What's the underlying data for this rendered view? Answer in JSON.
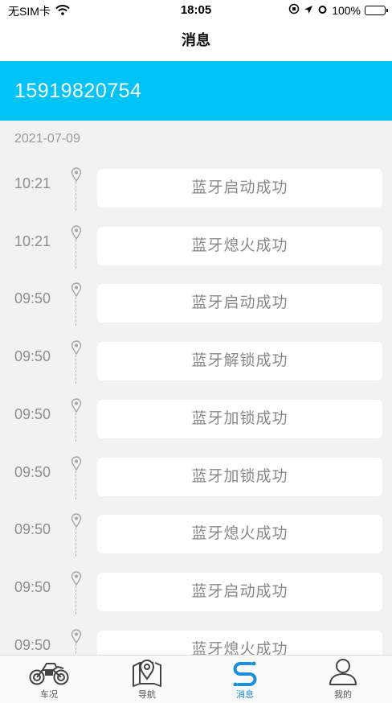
{
  "status_bar": {
    "carrier": "无SIM卡",
    "time": "18:05",
    "battery": "100%"
  },
  "header": {
    "title": "消息"
  },
  "account": {
    "phone": "15919820754"
  },
  "date": "2021-07-09",
  "messages": [
    {
      "time": "10:21",
      "text": "蓝牙启动成功"
    },
    {
      "time": "10:21",
      "text": "蓝牙熄火成功"
    },
    {
      "time": "09:50",
      "text": "蓝牙启动成功"
    },
    {
      "time": "09:50",
      "text": "蓝牙解锁成功"
    },
    {
      "time": "09:50",
      "text": "蓝牙加锁成功"
    },
    {
      "time": "09:50",
      "text": "蓝牙加锁成功"
    },
    {
      "time": "09:50",
      "text": "蓝牙熄火成功"
    },
    {
      "time": "09:50",
      "text": "蓝牙启动成功"
    },
    {
      "time": "09:50",
      "text": "蓝牙熄火成功"
    }
  ],
  "tabs": [
    {
      "label": "车况",
      "icon": "motorcycle-icon",
      "active": false
    },
    {
      "label": "导航",
      "icon": "map-pin-icon",
      "active": false
    },
    {
      "label": "消息",
      "icon": "message-icon",
      "active": true
    },
    {
      "label": "我的",
      "icon": "person-icon",
      "active": false
    }
  ],
  "colors": {
    "accent": "#00c4f5",
    "tab_active": "#1a8fdd",
    "background": "#f2f2f2"
  }
}
